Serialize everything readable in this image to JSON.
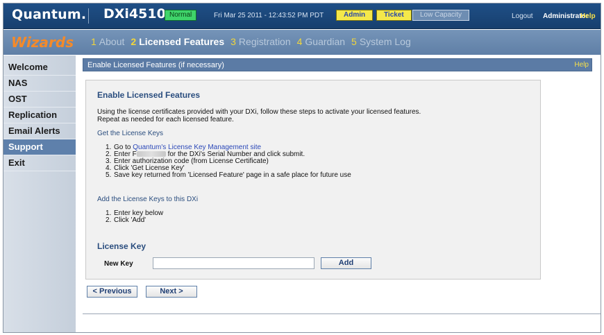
{
  "header": {
    "brand": "Quantum.",
    "model": "DXi4510",
    "status": "Normal",
    "datetime": "Fri Mar 25 2011 - 12:43:52 PM PDT",
    "admin_label": "Admin",
    "ticket_label": "Ticket",
    "low_capacity_label": "Low Capacity",
    "logout_label": "Logout",
    "user": "Administrator",
    "help_label": "Help"
  },
  "wizard": {
    "title": "Wizards",
    "steps": [
      {
        "num": "1",
        "label": "About"
      },
      {
        "num": "2",
        "label": "Licensed Features"
      },
      {
        "num": "3",
        "label": "Registration"
      },
      {
        "num": "4",
        "label": "Guardian"
      },
      {
        "num": "5",
        "label": "System Log"
      }
    ]
  },
  "sidebar": {
    "items": [
      {
        "label": "Welcome"
      },
      {
        "label": "NAS"
      },
      {
        "label": "OST"
      },
      {
        "label": "Replication"
      },
      {
        "label": "Email Alerts"
      },
      {
        "label": "Support"
      },
      {
        "label": "Exit"
      }
    ]
  },
  "panel": {
    "title": "Enable Licensed Features (if necessary)",
    "help_label": "Help",
    "heading": "Enable Licensed Features",
    "intro_line1": "Using the license certificates provided with your DXi, follow these steps to activate your licensed features.",
    "intro_line2": "Repeat as needed for each licensed feature.",
    "get_keys_heading": "Get the License Keys",
    "get_keys_steps": {
      "s1_prefix": "Go to ",
      "s1_link": "Quantum's License Key Management site",
      "s2_prefix": "Enter F",
      "s2_suffix": " for the DXi's Serial Number and click submit.",
      "s3": "Enter authorization code (from License Certificate)",
      "s4": "Click 'Get License Key'",
      "s5": "Save key returned from 'Licensed Feature' page in a safe place for future use"
    },
    "add_keys_heading": "Add the License Keys to this DXi",
    "add_keys_steps": {
      "s1": "Enter key below",
      "s2": "Click 'Add'"
    },
    "license_key_heading": "License Key",
    "new_key_label": "New Key",
    "new_key_value": "",
    "add_button": "Add"
  },
  "nav_buttons": {
    "previous": "< Previous",
    "next": "Next >"
  },
  "colors": {
    "header_bg": "#1f4f86",
    "wizard_bar_bg": "#6786ae",
    "wizard_title": "#f48a2a",
    "step_number": "#f2d63a",
    "status_normal": "#3fd46a",
    "badge_yellow": "#f4e84a",
    "panel_head_bg": "#5b7ba5",
    "sidebar_selected": "#5e80ab"
  },
  "icons": {}
}
